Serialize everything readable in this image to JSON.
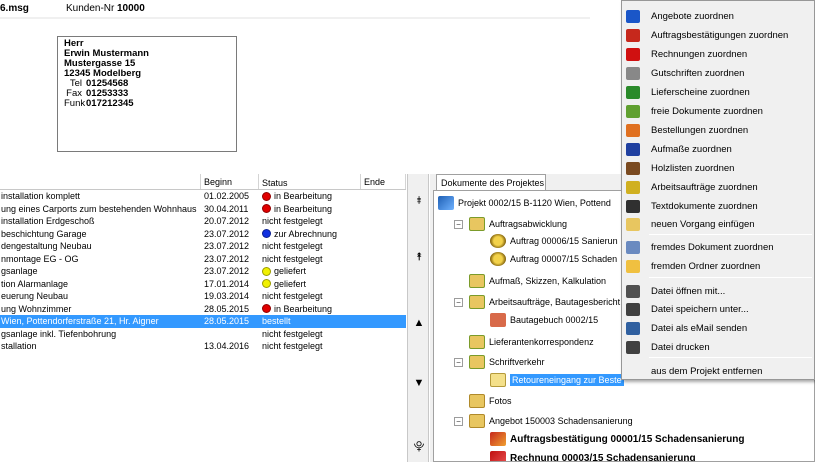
{
  "header": {
    "file_name": "6.msg",
    "customer_no_label": "Kunden-Nr",
    "customer_no": "10000"
  },
  "address": {
    "salutation": "Herr",
    "name": "Erwin Mustermann",
    "street": "Mustergasse 15",
    "city": "12345  Modelberg",
    "tel_label": "Tel",
    "tel": "01254568",
    "fax_label": "Fax",
    "fax": "01253333",
    "funk_label": "Funk",
    "funk": "017212345"
  },
  "projects": {
    "columns": [
      "",
      "Beginn",
      "Status",
      "Ende"
    ],
    "rows": [
      {
        "name": "installation komplett",
        "begin": "01.02.2005",
        "status": "in Bearbeitung",
        "status_color": "#e00000",
        "end": ""
      },
      {
        "name": "ung eines Carports zum bestehenden Wohnhaus",
        "begin": "30.04.2011",
        "status": "in Bearbeitung",
        "status_color": "#e00000",
        "end": ""
      },
      {
        "name": "installation Erdgeschoß",
        "begin": "20.07.2012",
        "status": "nicht festgelegt",
        "status_color": "",
        "end": ""
      },
      {
        "name": "beschichtung Garage",
        "begin": "23.07.2012",
        "status": "zur Abrechnung",
        "status_color": "#1030e0",
        "end": ""
      },
      {
        "name": "dengestaltung Neubau",
        "begin": "23.07.2012",
        "status": "nicht festgelegt",
        "status_color": "",
        "end": ""
      },
      {
        "name": "nmontage EG - OG",
        "begin": "23.07.2012",
        "status": "nicht festgelegt",
        "status_color": "",
        "end": ""
      },
      {
        "name": "gsanlage",
        "begin": "23.07.2012",
        "status": "geliefert",
        "status_color": "#f0f000",
        "end": ""
      },
      {
        "name": "tion Alarmanlage",
        "begin": "17.01.2014",
        "status": "geliefert",
        "status_color": "#f0f000",
        "end": ""
      },
      {
        "name": "euerung Neubau",
        "begin": "19.03.2014",
        "status": "nicht festgelegt",
        "status_color": "",
        "end": ""
      },
      {
        "name": "ung Wohnzimmer",
        "begin": "28.05.2015",
        "status": "in Bearbeitung",
        "status_color": "#e00000",
        "end": ""
      },
      {
        "name": "Wien, Pottendorferstraße 21, Hr. Aigner",
        "begin": "28.05.2015",
        "status": "bestellt",
        "status_color": "",
        "end": "",
        "selected": true
      },
      {
        "name": "gsanlage inkl. Tiefenbohrung",
        "begin": "",
        "status": "nicht festgelegt",
        "status_color": "",
        "end": ""
      },
      {
        "name": "stallation",
        "begin": "13.04.2016",
        "status": "nicht festgelegt",
        "status_color": "",
        "end": ""
      }
    ]
  },
  "scroll": {
    "top": "⯒",
    "pageup": "⯭",
    "up": "▲",
    "down": "▼",
    "bottom": "⯓"
  },
  "docs": {
    "tab": "Dokumente des Projektes",
    "tree": [
      {
        "label": "Projekt 0002/15 B-1120 Wien, Pottend",
        "icon": "project-icon"
      },
      {
        "label": "Auftragsabwicklung",
        "icon": "folder-icon"
      },
      {
        "label": "Auftrag 00006/15 Sanierun",
        "icon": "order-icon"
      },
      {
        "label": "Auftrag 00007/15 Schaden",
        "icon": "order-icon"
      },
      {
        "label": "Aufmaß, Skizzen, Kalkulation",
        "icon": "folder-icon"
      },
      {
        "label": "Arbeitsaufträge, Bautagesbericht",
        "icon": "folder-icon"
      },
      {
        "label": "Bautagebuch 0002/15",
        "icon": "book-icon"
      },
      {
        "label": "Lieferantenkorrespondenz",
        "icon": "folder-icon"
      },
      {
        "label": "Schriftverkehr",
        "icon": "folder-icon"
      },
      {
        "label": "Retoureneingang zur Beste",
        "icon": "mail-icon"
      },
      {
        "label": "Fotos",
        "icon": "folder-icon"
      },
      {
        "label": "Angebot 150003 Schadensanierung",
        "icon": "folder-icon"
      },
      {
        "label": "Auftragsbestätigung 00001/15 Schadensanierung",
        "icon": "confirmation-icon"
      },
      {
        "label": "Rechnung 00003/15 Schadensanierung",
        "icon": "invoice-icon"
      }
    ]
  },
  "menu": {
    "items": [
      {
        "label": "Angebote zuordnen",
        "icon": "offer-icon",
        "color": "#1a56c8"
      },
      {
        "label": "Auftragsbestätigungen zuordnen",
        "icon": "confirmation-icon",
        "color": "#c6281c"
      },
      {
        "label": "Rechnungen zuordnen",
        "icon": "invoice-icon",
        "color": "#d01010"
      },
      {
        "label": "Gutschriften zuordnen",
        "icon": "credit-icon",
        "color": "#888888"
      },
      {
        "label": "Lieferscheine zuordnen",
        "icon": "delivery-icon",
        "color": "#2a8a2a"
      },
      {
        "label": "freie Dokumente zuordnen",
        "icon": "free-document-icon",
        "color": "#60a030"
      },
      {
        "label": "Bestellungen zuordnen",
        "icon": "order-icon",
        "color": "#e07020"
      },
      {
        "label": "Aufmaße zuordnen",
        "icon": "measure-icon",
        "color": "#2040a0"
      },
      {
        "label": "Holzlisten zuordnen",
        "icon": "wood-icon",
        "color": "#7a4a20"
      },
      {
        "label": "Arbeitsaufträge zuordnen",
        "icon": "work-order-icon",
        "color": "#d0b020"
      },
      {
        "label": "Textdokumente zuordnen",
        "icon": "text-document-icon",
        "color": "#303030"
      },
      {
        "label": "neuen Vorgang einfügen",
        "icon": "new-process-icon",
        "color": "#e8c660"
      },
      {
        "label": "fremdes Dokument zuordnen",
        "icon": "external-document-icon",
        "color": "#6a8ac0"
      },
      {
        "label": "fremden Ordner zuordnen",
        "icon": "external-folder-icon",
        "color": "#f0c040"
      },
      {
        "label": "Datei öffnen mit...",
        "icon": "open-file-icon",
        "color": "#505050"
      },
      {
        "label": "Datei speichern unter...",
        "icon": "save-file-icon",
        "color": "#404040"
      },
      {
        "label": "Datei als eMail senden",
        "icon": "send-mail-icon",
        "color": "#3060a0"
      },
      {
        "label": "Datei drucken",
        "icon": "print-icon",
        "color": "#404040"
      },
      {
        "label": "aus dem Projekt entfernen",
        "icon": "",
        "color": ""
      }
    ]
  }
}
